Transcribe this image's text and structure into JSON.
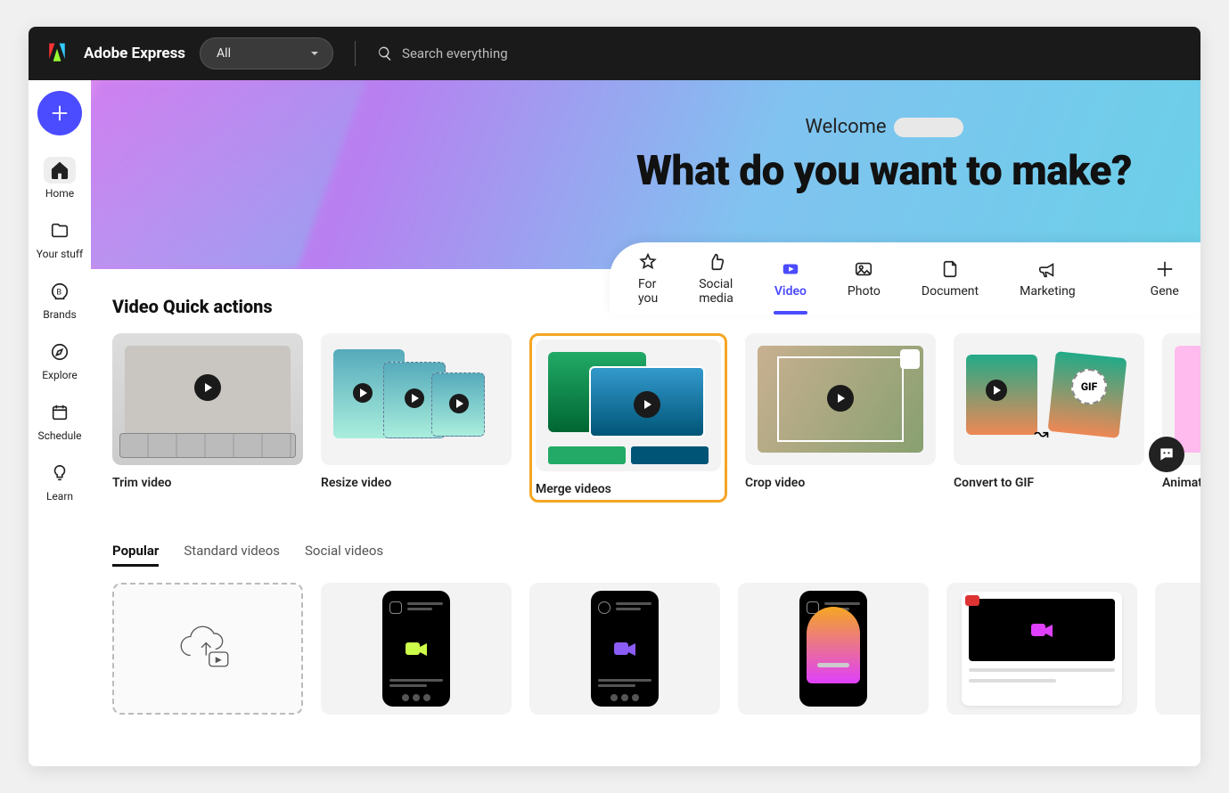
{
  "brand": "Adobe Express",
  "topbar": {
    "filter_label": "All",
    "search_placeholder": "Search everything"
  },
  "sidebar": {
    "items": [
      {
        "id": "home",
        "label": "Home",
        "active": true
      },
      {
        "id": "your-stuff",
        "label": "Your stuff",
        "active": false
      },
      {
        "id": "brands",
        "label": "Brands",
        "active": false
      },
      {
        "id": "explore",
        "label": "Explore",
        "active": false
      },
      {
        "id": "schedule",
        "label": "Schedule",
        "active": false
      },
      {
        "id": "learn",
        "label": "Learn",
        "active": false
      }
    ]
  },
  "hero": {
    "welcome": "Welcome",
    "title": "What do you want to make?"
  },
  "categories": [
    {
      "id": "for-you",
      "label": "For you",
      "active": false
    },
    {
      "id": "social-media",
      "label": "Social media",
      "active": false
    },
    {
      "id": "video",
      "label": "Video",
      "active": true
    },
    {
      "id": "photo",
      "label": "Photo",
      "active": false
    },
    {
      "id": "document",
      "label": "Document",
      "active": false
    },
    {
      "id": "marketing",
      "label": "Marketing",
      "active": false
    },
    {
      "id": "generate",
      "label": "Gene",
      "active": false
    }
  ],
  "quick_actions": {
    "title": "Video Quick actions",
    "items": [
      {
        "id": "trim",
        "label": "Trim video",
        "highlighted": false
      },
      {
        "id": "resize",
        "label": "Resize video",
        "highlighted": false
      },
      {
        "id": "merge",
        "label": "Merge videos",
        "highlighted": true
      },
      {
        "id": "crop",
        "label": "Crop video",
        "highlighted": false
      },
      {
        "id": "gif",
        "label": "Convert to GIF",
        "highlighted": false
      },
      {
        "id": "animate",
        "label": "Animate fro",
        "highlighted": false
      }
    ],
    "gif_badge": "GIF"
  },
  "template_tabs": [
    {
      "id": "popular",
      "label": "Popular",
      "active": true
    },
    {
      "id": "standard",
      "label": "Standard videos",
      "active": false
    },
    {
      "id": "social",
      "label": "Social videos",
      "active": false
    }
  ]
}
